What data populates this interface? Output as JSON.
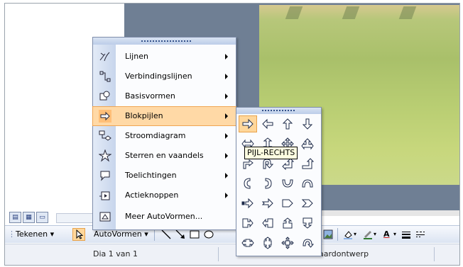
{
  "menu": {
    "items": [
      {
        "label": "Lijnen",
        "icon": "lines-icon"
      },
      {
        "label": "Verbindingslijnen",
        "icon": "connectors-icon"
      },
      {
        "label": "Basisvormen",
        "icon": "basic-shapes-icon"
      },
      {
        "label": "Blokpijlen",
        "icon": "block-arrows-icon",
        "highlighted": true
      },
      {
        "label": "Stroomdiagram",
        "icon": "flowchart-icon"
      },
      {
        "label": "Sterren en vaandels",
        "icon": "stars-banners-icon"
      },
      {
        "label": "Toelichtingen",
        "icon": "callouts-icon"
      },
      {
        "label": "Actieknoppen",
        "icon": "action-buttons-icon"
      },
      {
        "label": "Meer AutoVormen...",
        "icon": "more-autoshapes-icon"
      }
    ]
  },
  "tooltip": "PIJL-RECHTS",
  "toolbar": {
    "draw_label": "Tekenen",
    "autoshapes_label": "AutoVormen"
  },
  "status": {
    "slide": "Dia 1 van 1",
    "design": "Standaardontwerp"
  },
  "colors": {
    "highlight": "#ffd9a6",
    "menu_border": "#7f8eab",
    "tooltip_bg": "#ffffe1"
  }
}
